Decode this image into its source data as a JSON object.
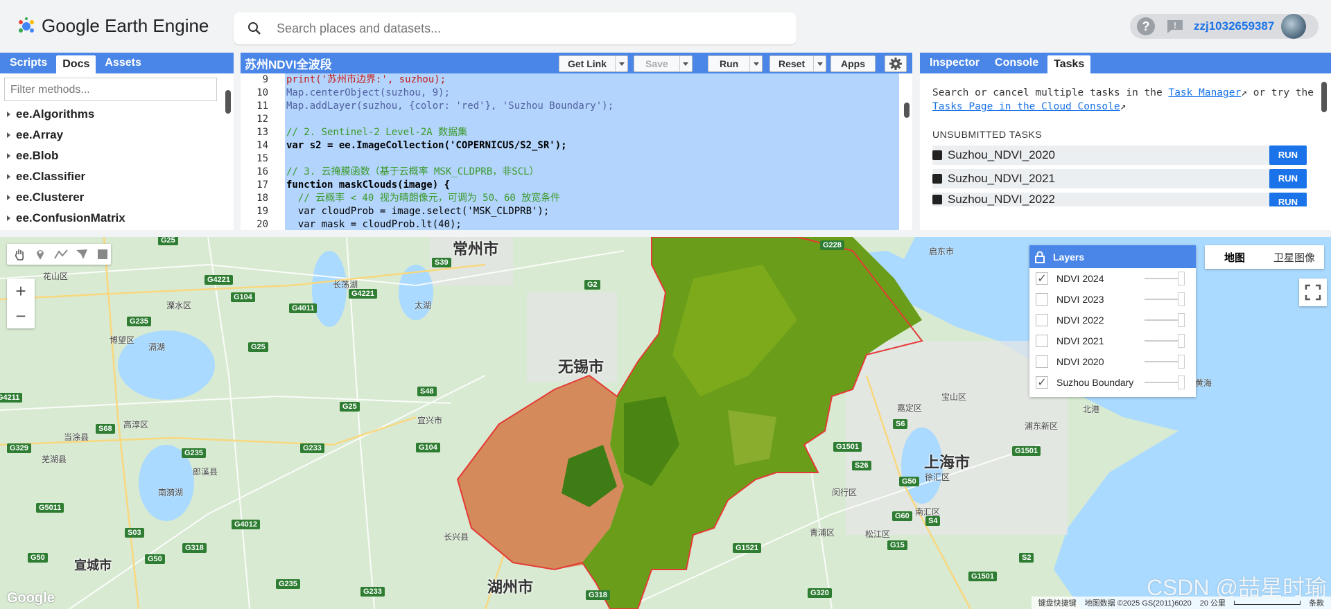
{
  "app": {
    "logo_text": "Google Earth Engine"
  },
  "search": {
    "placeholder": "Search places and datasets..."
  },
  "user": {
    "help": "?",
    "name": "zzj1032659387"
  },
  "left_panel": {
    "tabs": [
      "Scripts",
      "Docs",
      "Assets"
    ],
    "active_tab": "Docs",
    "filter_placeholder": "Filter methods...",
    "methods": [
      "ee.Algorithms",
      "ee.Array",
      "ee.Blob",
      "ee.Classifier",
      "ee.Clusterer",
      "ee.ConfusionMatrix"
    ]
  },
  "editor": {
    "title": "苏州NDVI全波段",
    "buttons": {
      "get_link": "Get Link",
      "save": "Save",
      "run": "Run",
      "reset": "Reset",
      "apps": "Apps"
    },
    "line_numbers": [
      "9",
      "10",
      "11",
      "12",
      "13",
      "14",
      "15",
      "16",
      "17",
      "18",
      "19",
      "20"
    ],
    "code_lines": [
      "print('苏州市边界:', suzhou);",
      "Map.centerObject(suzhou, 9);",
      "Map.addLayer(suzhou, {color: 'red'}, 'Suzhou Boundary');",
      "",
      "// 2. Sentinel-2 Level-2A 数据集",
      "var s2 = ee.ImageCollection('COPERNICUS/S2_SR');",
      "",
      "// 3. 云掩膜函数（基于云概率 MSK_CLDPRB，非SCL）",
      "function maskClouds(image) {",
      "  // 云概率 < 40 视为晴朗像元，可调为 50、60 放宽条件",
      "  var cloudProb = image.select('MSK_CLDPRB');",
      "  var mask = cloudProb.lt(40);"
    ]
  },
  "right_panel": {
    "tabs": [
      "Inspector",
      "Console",
      "Tasks"
    ],
    "active_tab": "Tasks",
    "intro_1": "Search or cancel multiple tasks in the ",
    "link_task_manager": "Task Manager",
    "intro_2": " or try the ",
    "link_tasks_page": "Tasks Page in the Cloud Console",
    "unsubmitted_label": "UNSUBMITTED TASKS",
    "tasks": [
      "Suzhou_NDVI_2020",
      "Suzhou_NDVI_2021",
      "Suzhou_NDVI_2022"
    ],
    "run_label": "RUN"
  },
  "map": {
    "layers_title": "Layers",
    "layers": [
      {
        "name": "NDVI 2024",
        "checked": true
      },
      {
        "name": "NDVI 2023",
        "checked": false
      },
      {
        "name": "NDVI 2022",
        "checked": false
      },
      {
        "name": "NDVI 2021",
        "checked": false
      },
      {
        "name": "NDVI 2020",
        "checked": false
      },
      {
        "name": "Suzhou Boundary",
        "checked": true
      }
    ],
    "map_types": [
      "地图",
      "卫星图像"
    ],
    "zoom_in": "+",
    "zoom_out": "−",
    "cities": {
      "changzhou": "常州市",
      "wuxi": "无锡市",
      "shanghai": "上海市",
      "huzhou": "湖州市",
      "xuancheng": "宣城市"
    },
    "small_labels": [
      "花山区",
      "溧水区",
      "博望区",
      "高淳区",
      "当涂县",
      "芜湖县",
      "郎溪县",
      "宜兴市",
      "长兴县",
      "启东市",
      "宝山区",
      "嘉定区",
      "黄海",
      "北港",
      "浦东新区",
      "青浦区",
      "松江区",
      "闵行区",
      "徐汇区",
      "南汇区",
      "滆湖",
      "长荡湖",
      "南漪湖",
      "太湖"
    ],
    "shields": [
      "G25",
      "S39",
      "G2",
      "G228",
      "G4221",
      "G104",
      "G4011",
      "G4221",
      "G235",
      "G25",
      "S48",
      "G25",
      "G104",
      "S68",
      "G233",
      "G235",
      "S6",
      "S26",
      "G50",
      "G60",
      "S4",
      "G15",
      "G1501",
      "G1501",
      "S2",
      "G5011",
      "S03",
      "G50",
      "G4012",
      "G318",
      "G50",
      "G235",
      "G233",
      "G318",
      "G320",
      "G1521",
      "G1501",
      "G4211",
      "G329"
    ],
    "attribution": [
      "键盘快捷键",
      "地图数据 ©2025 GS(2011)6020",
      "20 公里",
      "条款"
    ],
    "google": "Google",
    "watermark": "CSDN @喆星时瑜"
  },
  "colors": {
    "accent": "#4a86e8",
    "run_blue": "#1a73e8",
    "code_selection": "#b3d4fc",
    "boundary": "#e53935"
  }
}
